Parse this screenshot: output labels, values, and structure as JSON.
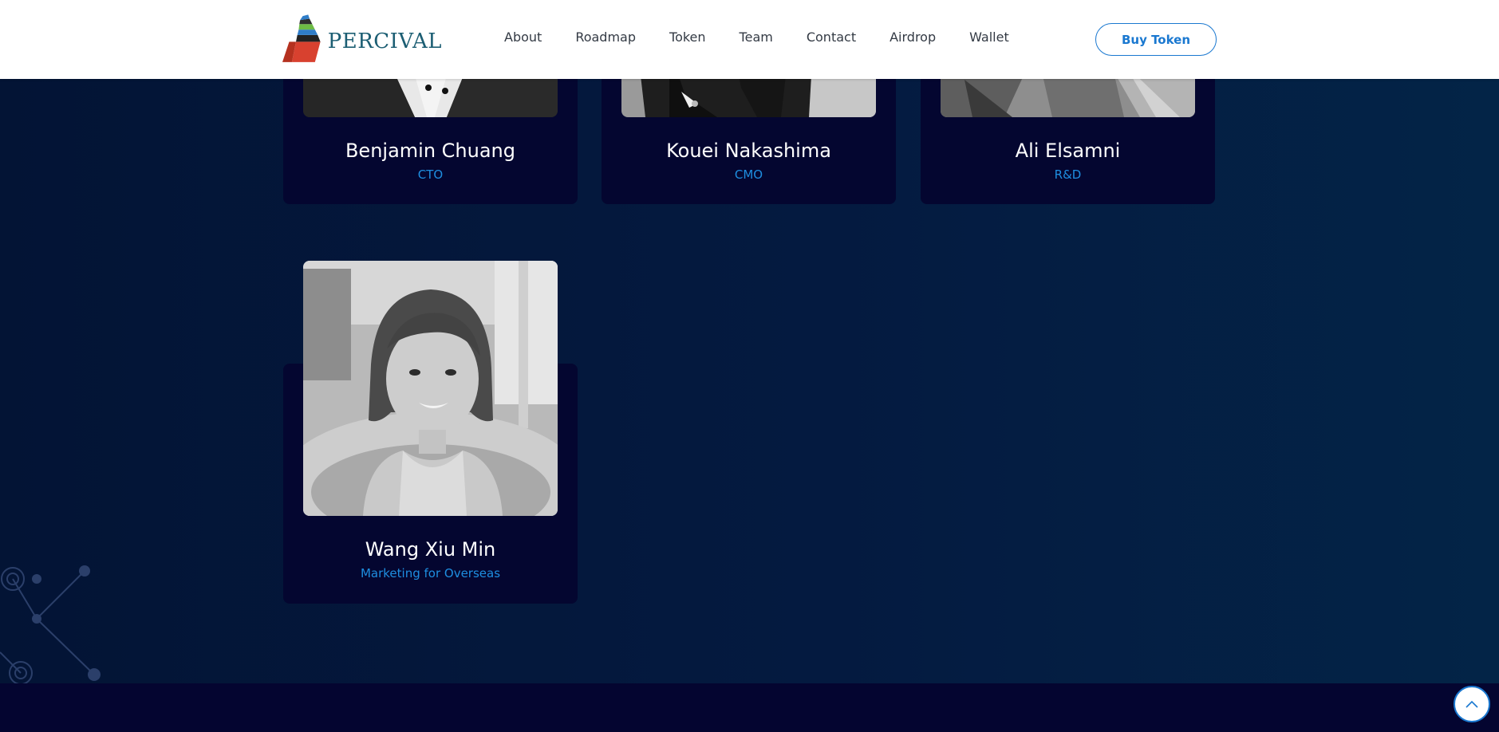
{
  "brand": {
    "name": "PERCIVAL"
  },
  "nav": {
    "items": [
      "About",
      "Roadmap",
      "Token",
      "Team",
      "Contact",
      "Airdrop",
      "Wallet"
    ],
    "cta_label": "Buy Token"
  },
  "team": {
    "members": [
      {
        "name": "Benjamin Chuang",
        "role": "CTO"
      },
      {
        "name": "Kouei Nakashima",
        "role": "CMO"
      },
      {
        "name": "Ali Elsamni",
        "role": "R&D"
      },
      {
        "name": "Wang Xiu Min",
        "role": "Marketing for Overseas"
      }
    ]
  },
  "icons": {
    "scroll_top": "chevron-up-icon",
    "logo": "percival-building-logo"
  },
  "colors": {
    "accent": "#1a78d0",
    "role_text": "#1e8ee0",
    "card_bg": "#040630",
    "page_bg": "#041a40"
  }
}
